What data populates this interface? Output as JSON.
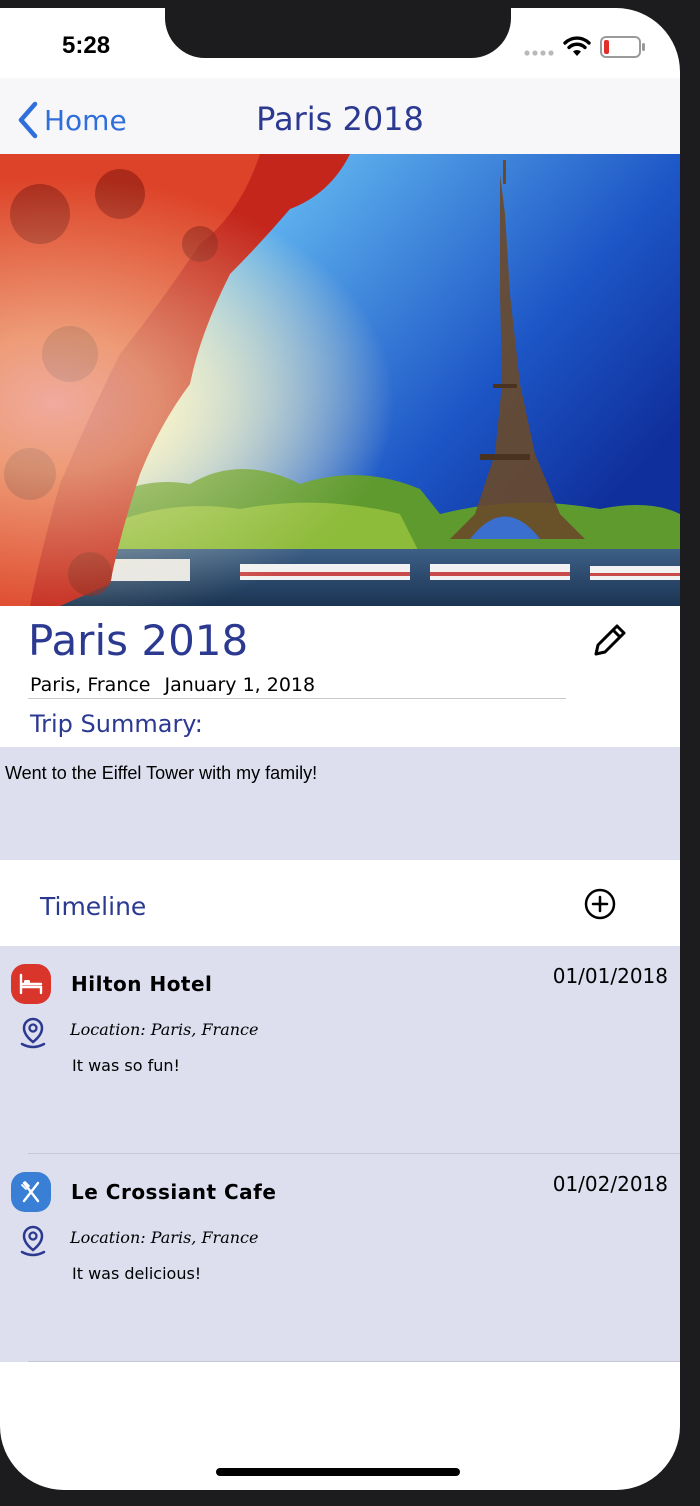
{
  "status_bar": {
    "time": "5:28"
  },
  "nav": {
    "back_label": "Home",
    "title": "Paris 2018"
  },
  "trip": {
    "title": "Paris 2018",
    "location": "Paris, France",
    "date": "January 1, 2018",
    "summary_label": "Trip Summary:",
    "summary": "Went to the Eiffel Tower with my family!"
  },
  "timeline": {
    "label": "Timeline",
    "entries": [
      {
        "name": "Hilton Hotel",
        "date": "01/01/2018",
        "location": "Location: Paris, France",
        "note": "It was so fun!",
        "icon": "bed-icon",
        "icon_color": "#d9352b"
      },
      {
        "name": "Le Crossiant Cafe",
        "date": "01/02/2018",
        "location": "Location: Paris, France",
        "note": "It was delicious!",
        "icon": "utensils-icon",
        "icon_color": "#3a7fd6"
      }
    ]
  },
  "colors": {
    "accent": "#2b3990",
    "link": "#2f6fdc",
    "panel": "#dddfef"
  }
}
